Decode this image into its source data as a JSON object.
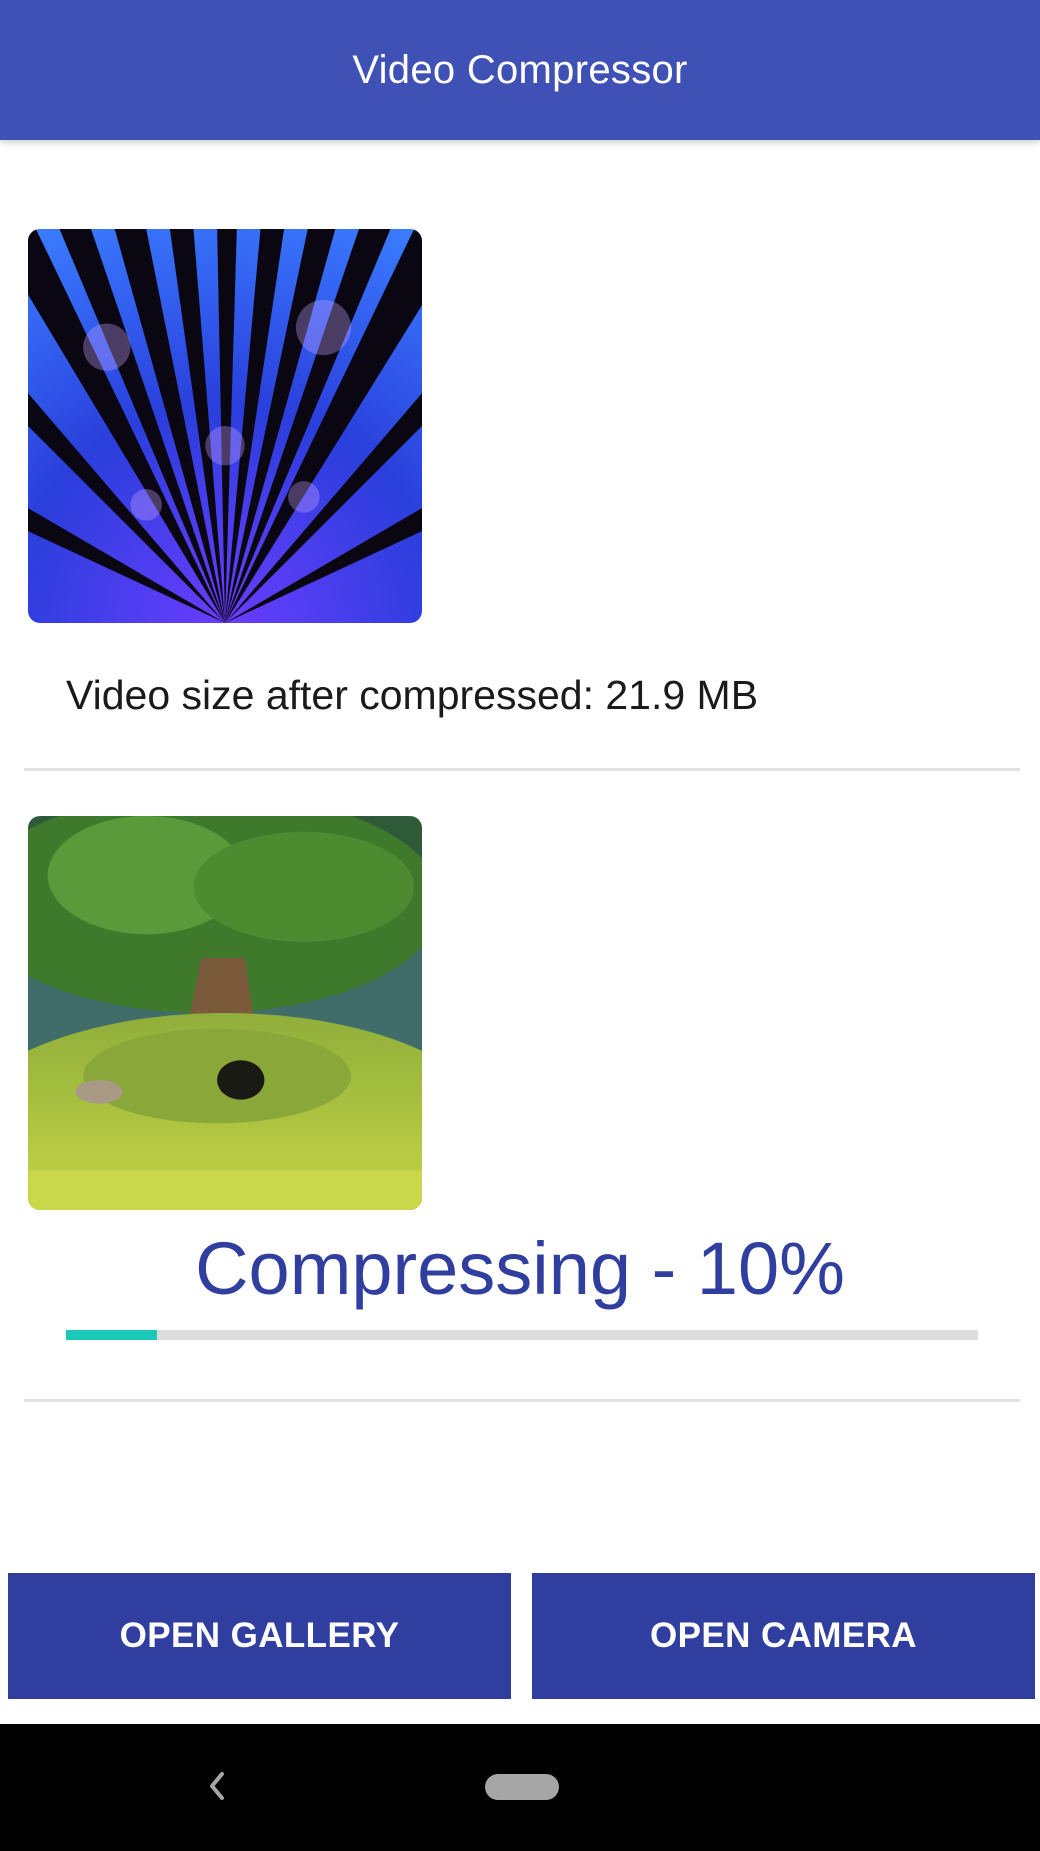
{
  "app": {
    "title": "Video Compressor"
  },
  "videos": [
    {
      "thumbnail": "kaleidoscope-thumbnail",
      "status": "Video size after compressed: 21.9 MB"
    },
    {
      "thumbnail": "tree-meadow-thumbnail",
      "status": "Compressing - 10%",
      "progress_percent": 10
    }
  ],
  "buttons": {
    "gallery": "OPEN GALLERY",
    "camera": "OPEN CAMERA"
  },
  "navbar": {
    "back_icon": "back-chevron-icon",
    "home_icon": "home-pill-icon"
  },
  "colors": {
    "appbar": "#3f51b5",
    "primary_dark": "#303f9f",
    "progress_accent": "#1bc9b8"
  }
}
